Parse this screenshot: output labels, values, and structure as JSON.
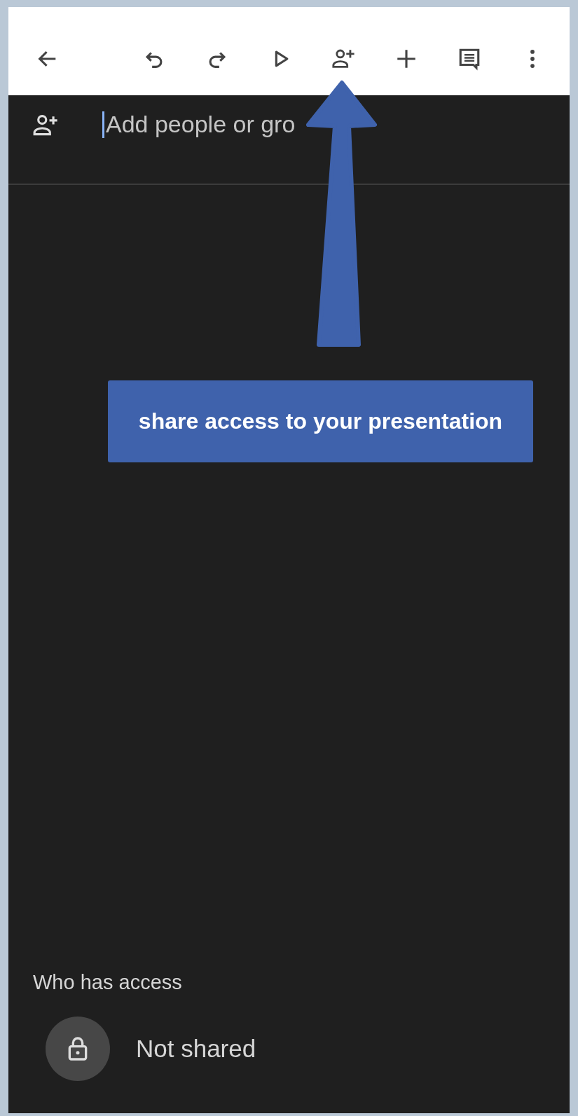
{
  "toolbar": {
    "buttons": [
      {
        "kind": "back"
      },
      {
        "kind": "undo"
      },
      {
        "kind": "redo"
      },
      {
        "kind": "present"
      },
      {
        "kind": "share"
      },
      {
        "kind": "add"
      },
      {
        "kind": "comment"
      },
      {
        "kind": "more"
      }
    ]
  },
  "share_field": {
    "placeholder": "Add people or gro"
  },
  "callout": {
    "text": "share access to your presentation"
  },
  "access": {
    "heading": "Who has access",
    "status": "Not shared"
  }
}
